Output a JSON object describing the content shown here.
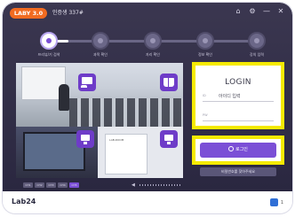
{
  "app": {
    "logo_text": "LABY 3.0",
    "title": "인증생 337#"
  },
  "window_controls": [
    "⌂",
    "⚙",
    "—",
    "✕"
  ],
  "stepper": {
    "steps": [
      {
        "label": "프리뷰/기 검색",
        "active": true
      },
      {
        "label": "과목 확인",
        "active": false
      },
      {
        "label": "자리 확인",
        "active": false
      },
      {
        "label": "정보 확인",
        "active": false
      },
      {
        "label": "강의 입력",
        "active": false
      }
    ]
  },
  "collage": {
    "doc_text": "LAB-ROOM"
  },
  "chips": [
    "CH1",
    "CH2",
    "CH3",
    "CH4",
    "CH5"
  ],
  "selected_chip": "CH5",
  "login": {
    "title": "LOGIN",
    "id_label": "ID",
    "id_value": "아이디 입력",
    "pw_label": "PW",
    "pw_value": "",
    "login_button": "로그인",
    "secondary_button": "비밀번호를 찾아주세요"
  },
  "footer": {
    "brand_prefix": "",
    "brand": "Lab24",
    "right_label": "1"
  },
  "colors": {
    "accent": "#7b4fd6",
    "highlight": "#f5ea00",
    "brand_orange": "#f26b21",
    "background_dark": "#2a2740"
  }
}
